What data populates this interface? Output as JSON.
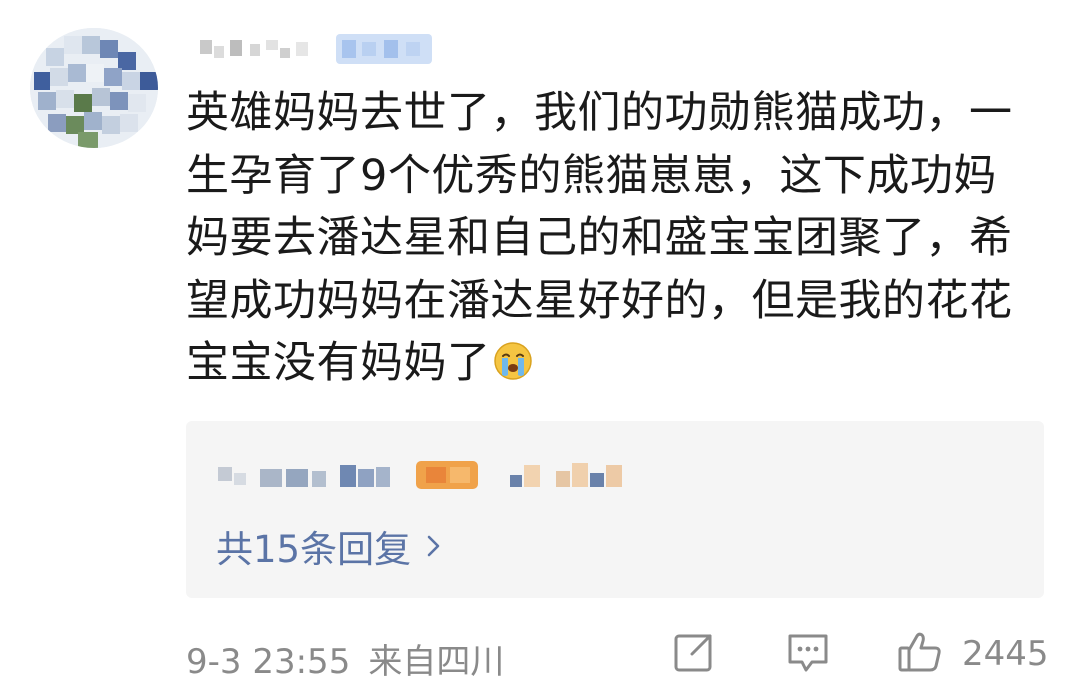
{
  "comment": {
    "lines": [
      "英雄妈妈去世了，我们的功勋熊猫成功，一",
      "生孕育了9个优秀的熊猫崽崽，这下成功妈",
      "妈要去潘达星和自己的和盛宝宝团聚了，希",
      "望成功妈妈在潘达星好好的，但是我的花花",
      "宝宝没有妈妈了"
    ],
    "emoji": "crying-face-icon"
  },
  "replies": {
    "count_label": "共15条回复"
  },
  "footer": {
    "date": "9-3 23:55",
    "location": "来自四川",
    "like_count": "2445"
  },
  "colors": {
    "text": "#1a1a1a",
    "link": "#5b74a6",
    "meta": "#8a8a8a",
    "reply_bg": "#f5f5f5"
  }
}
